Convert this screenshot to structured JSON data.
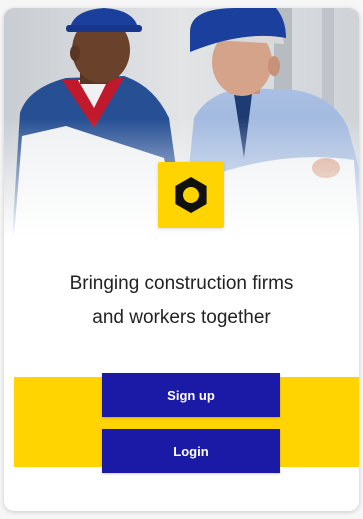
{
  "brand": {
    "logo_icon": "hexagon-bolt-icon",
    "logo_color": "#ffd400",
    "accent": "#ffd400",
    "button_color": "#1a1aa6"
  },
  "hero": {
    "image": "two-construction-workers-hard-hats-reviewing-blueprints-photo"
  },
  "tagline": {
    "line1": "Bringing construction firms",
    "line2": "and workers together"
  },
  "actions": {
    "signup_label": "Sign up",
    "login_label": "Login"
  }
}
